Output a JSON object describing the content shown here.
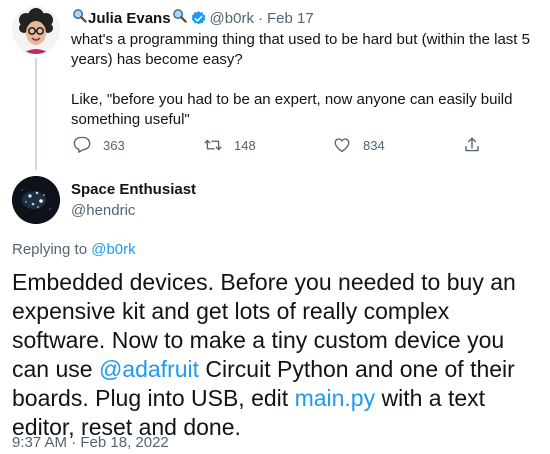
{
  "tweet1": {
    "author_name": "Julia Evans",
    "handle": "@b0rk",
    "separator": "·",
    "date": "Feb 17",
    "paragraph1": "what's a programming thing that used to be hard but (within the last 5 years) has become easy?",
    "paragraph2": "Like, \"before you had to be an expert, now anyone can easily build something useful\"",
    "actions": {
      "replies": "363",
      "retweets": "148",
      "likes": "834"
    }
  },
  "tweet2": {
    "author_name": "Space Enthusiast",
    "handle": "@hendric",
    "replying_to_label": "Replying to",
    "replying_to_handle": "@b0rk",
    "text_part1": "Embedded devices. Before you needed to buy an expensive kit and get lots of really complex software. Now to make a tiny custom device you can use ",
    "mention": "@adafruit",
    "text_part2": " Circuit Python and one of their boards. Plug into USB, edit ",
    "file_link": "main.py",
    "text_part3": " with a text editor, reset and done.",
    "timestamp": "9:37 AM · Feb 18, 2022"
  },
  "colors": {
    "link": "#1d9bf0",
    "secondary_text": "#536471",
    "thread_line": "#cfd9de"
  },
  "icons": [
    "magnifier-emoji-icon",
    "verified-badge-icon",
    "reply-icon",
    "retweet-icon",
    "like-icon",
    "share-icon"
  ]
}
